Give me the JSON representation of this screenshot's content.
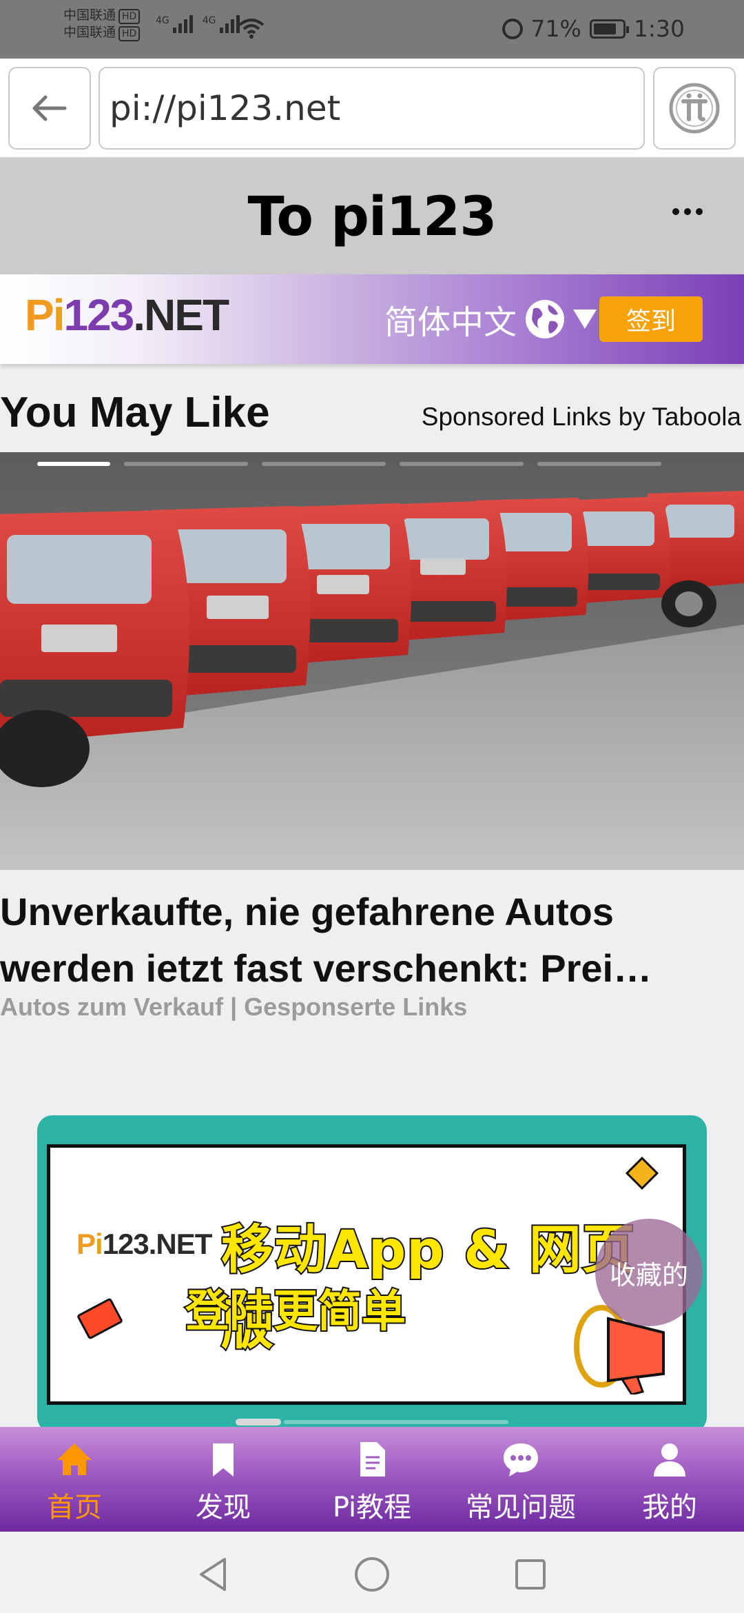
{
  "status_bar": {
    "carrier_1": "中国联通",
    "carrier_2": "中国联通",
    "hd_badge": "HD",
    "network_1": "4G",
    "network_2": "4G",
    "battery": "71%",
    "time": "1:30"
  },
  "browser": {
    "url": "pi://pi123.net",
    "page_title": "To pi123"
  },
  "site_header": {
    "logo_text": "Pi123.NET",
    "language": "简体中文",
    "signin_label": "签到"
  },
  "feed": {
    "section_title": "You May Like",
    "sponsor_label": "Sponsored Links by Taboola",
    "ad": {
      "title": "Unverkaufte, nie gefahrene Autos werden ietzt fast verschenkt: Prei…",
      "source": "Autos zum Verkauf | Gesponserte Links"
    }
  },
  "promo": {
    "logo_text": "Pi123.NET",
    "line1": "移动App & 网页版",
    "line2": "登陆更简单"
  },
  "favorite_bubble": "收藏的",
  "tabs": [
    {
      "label": "首页",
      "icon": "home-icon",
      "active": true
    },
    {
      "label": "发现",
      "icon": "bookmark-icon",
      "active": false
    },
    {
      "label": "Pi教程",
      "icon": "document-icon",
      "active": false
    },
    {
      "label": "常见问题",
      "icon": "chat-icon",
      "active": false
    },
    {
      "label": "我的",
      "icon": "user-icon",
      "active": false
    }
  ],
  "colors": {
    "accent_orange": "#f6a30a",
    "tab_active": "#ff9800",
    "brand_purple": "#7a3fb5",
    "promo_teal": "#2db3a6"
  }
}
